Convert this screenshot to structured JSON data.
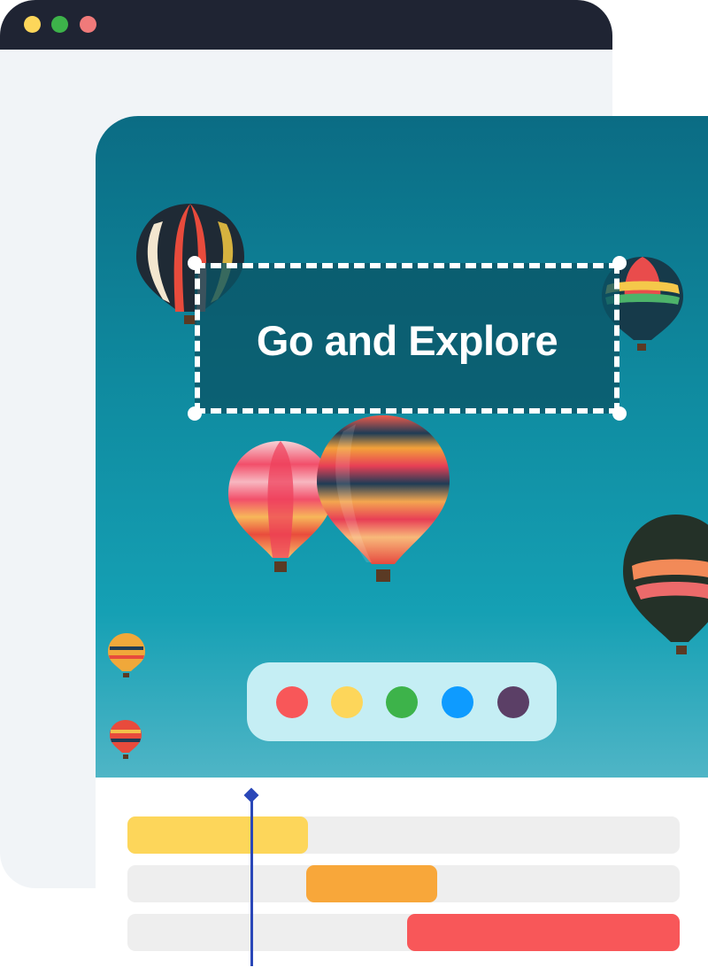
{
  "window": {
    "controls": [
      {
        "name": "minimize",
        "color": "#fdd65a"
      },
      {
        "name": "maximize",
        "color": "#3db34a"
      },
      {
        "name": "close",
        "color": "#f07a7a"
      }
    ]
  },
  "canvas": {
    "headline": "Go and Explore"
  },
  "palette": {
    "swatches": [
      "#f85759",
      "#fdd65a",
      "#3db34a",
      "#0e9bff",
      "#5b3f66"
    ]
  },
  "timeline": {
    "tracks": [
      {
        "clip_color": "#fdd65a"
      },
      {
        "clip_color": "#f8a73a"
      },
      {
        "clip_color": "#f85759"
      }
    ]
  },
  "colors": {
    "sky_top": "#0b6c84",
    "sky_bottom": "#4fb5c6",
    "window_bar": "#1f2433",
    "playhead": "#2a47b8"
  }
}
